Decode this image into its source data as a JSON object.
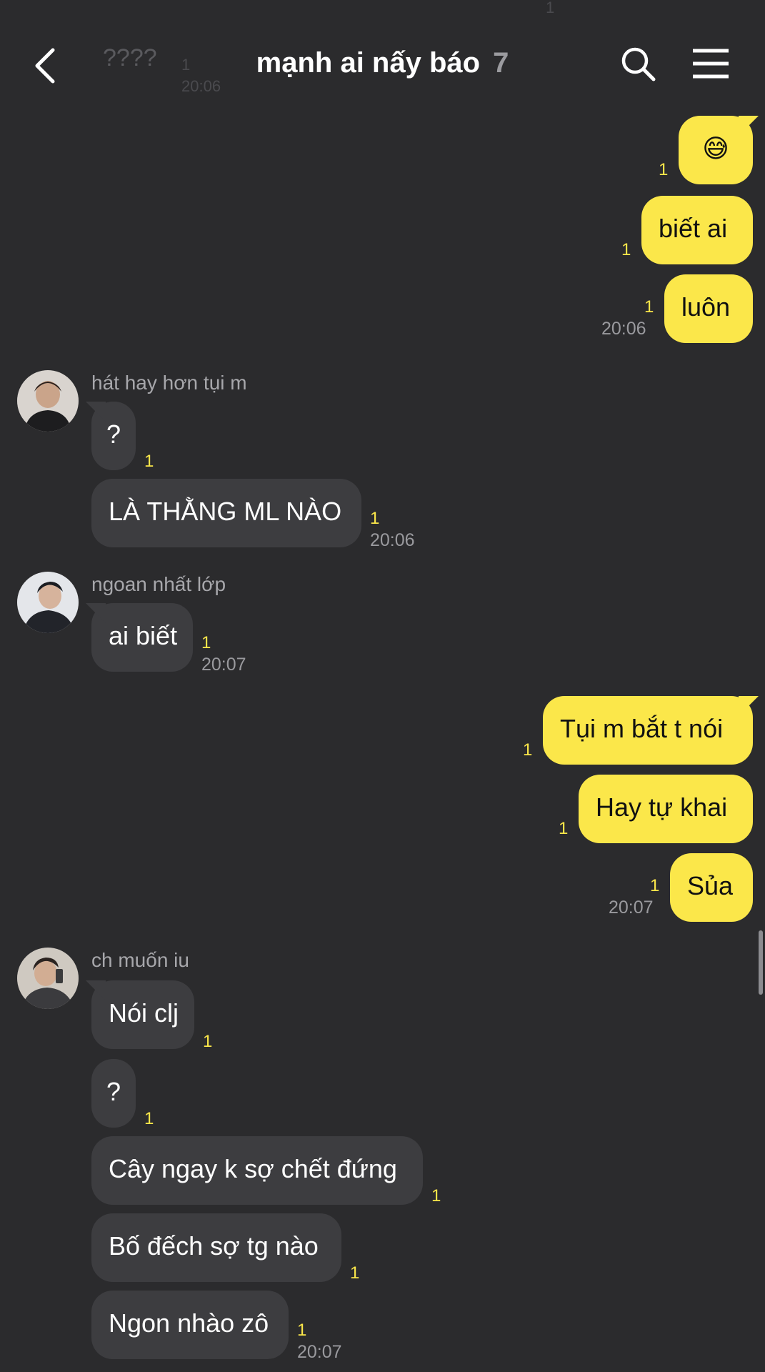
{
  "header": {
    "title": "mạnh ai nấy báo",
    "member_count": "7",
    "ghost_text": "????",
    "ghost_unread": "1",
    "ghost_time": "20:06",
    "ghost_top_unread": "1"
  },
  "messages": {
    "m1": {
      "text": "😅",
      "unread": "1"
    },
    "m2": {
      "text": "biết ai",
      "unread": "1"
    },
    "m3": {
      "text": "luôn",
      "unread": "1",
      "time": "20:06"
    },
    "g1": {
      "sender": "hát hay hơn tụi m"
    },
    "m4": {
      "text": "?",
      "unread": "1"
    },
    "m5": {
      "text": "LÀ THẰNG ML NÀO",
      "unread": "1",
      "time": "20:06"
    },
    "g2": {
      "sender": "ngoan nhất lớp"
    },
    "m6": {
      "text": "ai biết",
      "unread": "1",
      "time": "20:07"
    },
    "m7": {
      "text": "Tụi m bắt t nói",
      "unread": "1"
    },
    "m8": {
      "text": "Hay tự khai",
      "unread": "1"
    },
    "m9": {
      "text": "Sủa",
      "unread": "1",
      "time": "20:07"
    },
    "g3": {
      "sender": "ch muốn iu"
    },
    "m10": {
      "text": "Nói clj",
      "unread": "1"
    },
    "m11": {
      "text": "?",
      "unread": "1"
    },
    "m12": {
      "text": "Cây ngay k sợ chết đứng",
      "unread": "1"
    },
    "m13": {
      "text": "Bố đếch sợ tg nào",
      "unread": "1"
    },
    "m14": {
      "text": "Ngon nhào zô",
      "unread": "1",
      "time": "20:07"
    }
  },
  "colors": {
    "background": "#2b2b2d",
    "my_bubble": "#fbe74a",
    "their_bubble": "#3d3d40",
    "unread": "#fbe74a",
    "meta_text": "#9a9a9e"
  },
  "icons": [
    "back-arrow-icon",
    "search-icon",
    "menu-icon"
  ]
}
